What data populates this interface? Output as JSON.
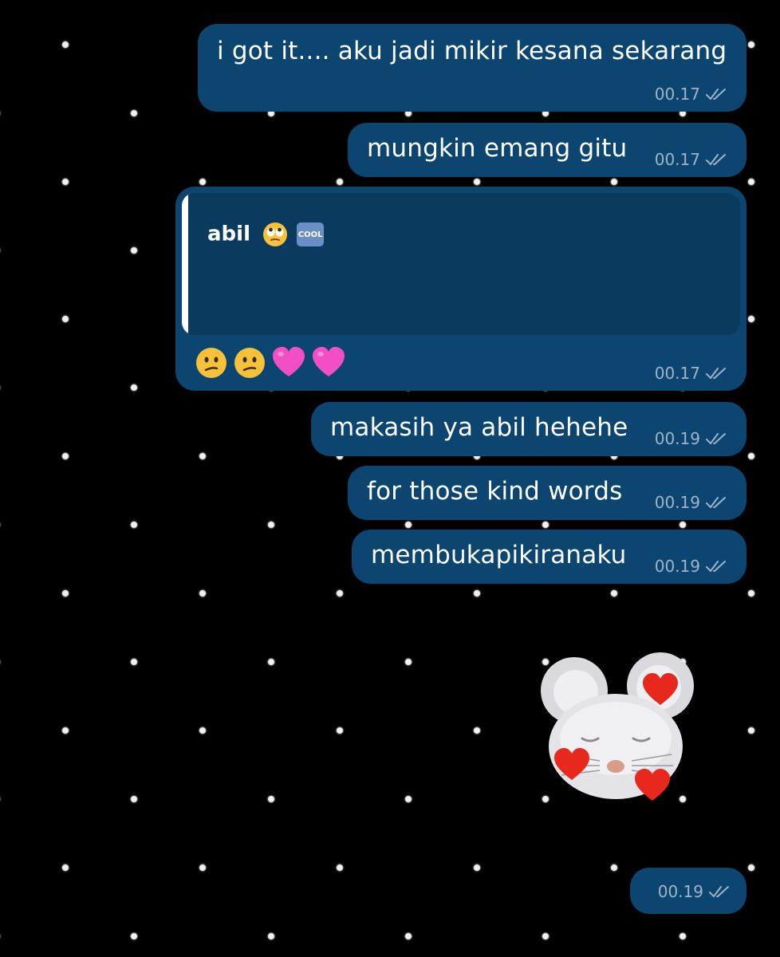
{
  "messages": [
    {
      "text": "i got it.... aku jadi mikir kesana sekarang",
      "time": "00.17"
    },
    {
      "text": "mungkin emang gitu",
      "time": "00.17"
    },
    {
      "reply_name": "abil",
      "reply_badge": "COOL",
      "time": "00.17",
      "reactions": [
        "confused-face",
        "confused-face",
        "pink-heart",
        "pink-heart"
      ]
    },
    {
      "text": "makasih ya abil hehehe",
      "time": "00.19"
    },
    {
      "text": "for those kind words",
      "time": "00.19"
    },
    {
      "text": "membukapikiranaku",
      "time": "00.19"
    },
    {
      "sticker": "mouse-heart-eyes-sticker",
      "time": "00.19"
    }
  ],
  "colors": {
    "bubble": "#0c4670",
    "quote": "#0a3b5f",
    "meta": "#9db4c9"
  }
}
